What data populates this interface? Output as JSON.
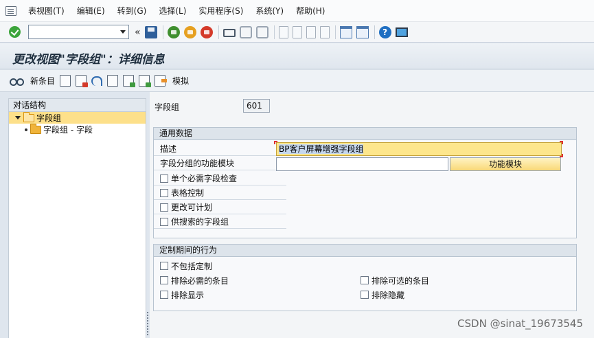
{
  "menu": {
    "items": [
      "表视图(T)",
      "编辑(E)",
      "转到(G)",
      "选择(L)",
      "实用程序(S)",
      "系统(Y)",
      "帮助(H)"
    ]
  },
  "toolbar": {
    "command_value": "",
    "history_glyph": "«"
  },
  "title": "更改视图\"字段组\"：详细信息",
  "app_toolbar": {
    "new_entries_label": "新条目",
    "simulate_label": "模拟"
  },
  "dialog_structure": {
    "header": "对话结构",
    "nodes": [
      {
        "label": "字段组",
        "selected": true,
        "expanded": true
      },
      {
        "label": "字段组 - 字段",
        "selected": false
      }
    ]
  },
  "form": {
    "field_group_label": "字段组",
    "field_group_value": "601",
    "general_data": {
      "header": "通用数据",
      "description_label": "描述",
      "description_value": "BP客户屏幕增强字段组",
      "function_module_label": "字段分组的功能模块",
      "function_module_value": "",
      "function_module_button": "功能模块",
      "checkboxes": [
        {
          "label": "单个必需字段检查",
          "checked": false
        },
        {
          "label": "表格控制",
          "checked": false
        },
        {
          "label": "更改可计划",
          "checked": false
        },
        {
          "label": "供搜索的字段组",
          "checked": false
        }
      ]
    },
    "custom_behavior": {
      "header": "定制期间的行为",
      "checkboxes": [
        {
          "label": "不包括定制",
          "checked": false
        },
        {
          "label": "排除必需的条目",
          "checked": false
        },
        {
          "label": "排除可选的条目",
          "checked": false
        },
        {
          "label": "排除显示",
          "checked": false
        },
        {
          "label": "排除隐藏",
          "checked": false
        }
      ]
    }
  },
  "watermark": "CSDN @sinat_19673545"
}
